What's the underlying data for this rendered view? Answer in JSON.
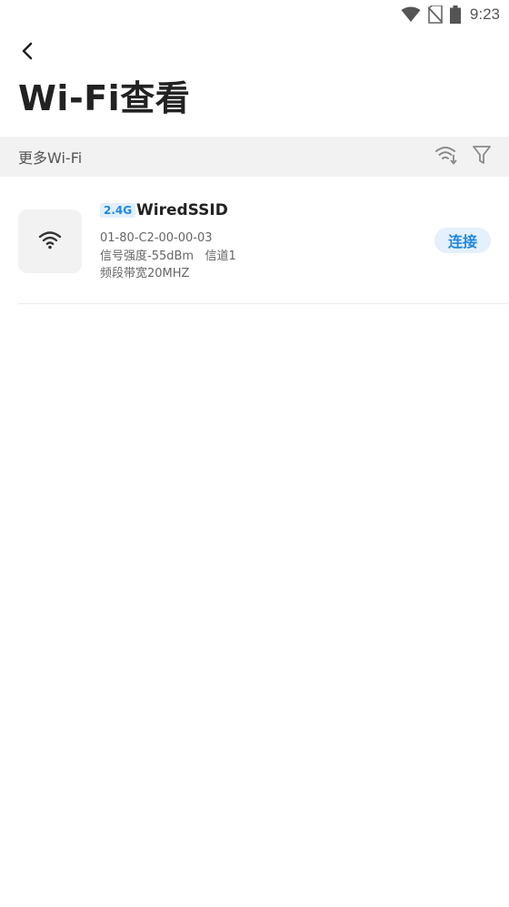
{
  "status_bar": {
    "time": "9:23",
    "icons": [
      "wifi-signal-icon",
      "no-sim-icon",
      "battery-icon"
    ]
  },
  "header": {
    "back_icon": "chevron-left-icon",
    "title": "Wi-Fi查看"
  },
  "section": {
    "label": "更多Wi-Fi",
    "tools": [
      "wifi-sort-icon",
      "filter-icon"
    ]
  },
  "wifi_list": [
    {
      "band": "2.4G",
      "ssid": "WiredSSID",
      "mac": "01-80-C2-00-00-03",
      "signal_line": "信号强度-55dBm   信道1",
      "bandwidth": "频段带宽20MHZ",
      "action_label": "连接",
      "icon": "wifi-icon"
    }
  ],
  "colors": {
    "accent": "#1e88e5",
    "badge_bg": "#e2efff",
    "section_bg": "#f2f2f2"
  }
}
